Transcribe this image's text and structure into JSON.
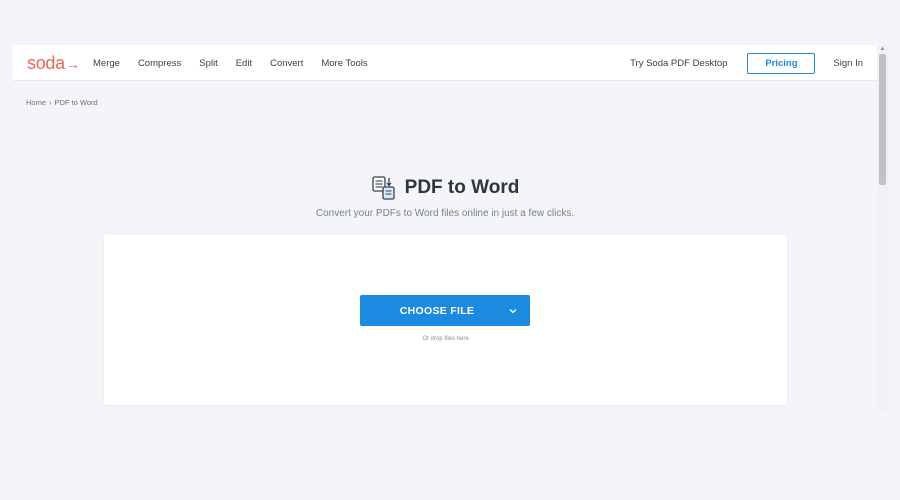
{
  "brand": {
    "logo": "soda",
    "logo_arrow": "→"
  },
  "nav": {
    "items": [
      {
        "label": "Merge"
      },
      {
        "label": "Compress"
      },
      {
        "label": "Split"
      },
      {
        "label": "Edit"
      },
      {
        "label": "Convert"
      },
      {
        "label": "More Tools"
      }
    ],
    "try_desktop": "Try Soda PDF Desktop",
    "pricing": "Pricing",
    "sign_in": "Sign In"
  },
  "breadcrumb": {
    "home": "Home",
    "separator": "›",
    "current": "PDF to Word"
  },
  "main": {
    "title": "PDF to Word",
    "subtitle": "Convert your PDFs to Word files online in just a few clicks.",
    "choose_file": "CHOOSE FILE",
    "drop_hint": "Or drop files here"
  },
  "icons": {
    "logo_arrow": "arrow-right-icon",
    "title": "pdf-to-word-icon",
    "dropdown": "chevron-down-icon",
    "scroll_up": "scroll-up-arrow-icon"
  },
  "colors": {
    "brand": "#f0625c",
    "accent": "#1a8be0",
    "page_bg": "#f4f5f9",
    "text": "#3a3f4b"
  }
}
